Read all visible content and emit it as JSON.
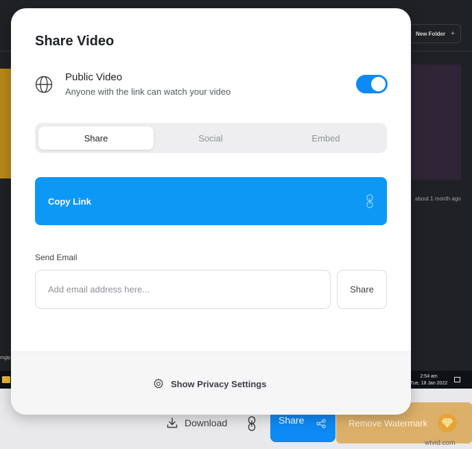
{
  "background": {
    "new_folder_label": "New Folder",
    "new_folder_plus": "+",
    "item_meta": "about 1 month ago",
    "left_file_label": "mgip",
    "clock_time": "2:54 am",
    "clock_date": "Tue, 18 Jan 2022"
  },
  "modal": {
    "title": "Share Video",
    "public_video": {
      "title": "Public Video",
      "description": "Anyone with the link can watch your video",
      "enabled": true
    },
    "tabs": [
      {
        "label": "Share",
        "active": true
      },
      {
        "label": "Social",
        "active": false
      },
      {
        "label": "Embed",
        "active": false
      }
    ],
    "copy_link_label": "Copy Link",
    "send_email": {
      "label": "Send Email",
      "placeholder": "Add email address here...",
      "value": "",
      "button_label": "Share"
    },
    "footer": {
      "privacy_label": "Show Privacy Settings"
    }
  },
  "toolbar": {
    "download_label": "Download",
    "share_label": "Share",
    "remove_watermark_label": "Remove Watermark"
  },
  "watermark_text": "wtvid.com",
  "colors": {
    "accent_blue": "#0d8af5",
    "copy_link_blue": "#0d98f5",
    "watermark_gold": "#ddb06a"
  }
}
